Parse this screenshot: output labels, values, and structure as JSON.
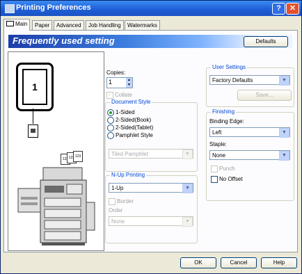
{
  "window": {
    "title": "Printing Preferences",
    "help_glyph": "?",
    "close_glyph": "✕"
  },
  "tabs": [
    {
      "label": "Main"
    },
    {
      "label": "Paper"
    },
    {
      "label": "Advanced"
    },
    {
      "label": "Job Handling"
    },
    {
      "label": "Watermarks"
    }
  ],
  "banner": {
    "title": "Frequently used setting",
    "defaults_label": "Defaults"
  },
  "preview": {
    "page_number": "1",
    "copies_labels": [
      "123",
      "123",
      "123"
    ]
  },
  "copies": {
    "label": "Copies:",
    "value": "1"
  },
  "collate": {
    "label": "Collate"
  },
  "document_style": {
    "label": "Document Style",
    "options": [
      "1-Sided",
      "2-Sided(Book)",
      "2-Sided(Tablet)",
      "Pamphlet Style"
    ],
    "selected": "1-Sided",
    "pamphlet_select": "Tiled Pamphlet"
  },
  "nup": {
    "label": "N-Up Printing",
    "value": "1-Up",
    "border_label": "Border",
    "order_label": "Order",
    "order_value": "None"
  },
  "user_settings": {
    "label": "User Settings",
    "value": "Factory Defaults",
    "save_label": "Save..."
  },
  "finishing": {
    "label": "Finishing",
    "binding_label": "Binding Edge:",
    "binding_value": "Left",
    "staple_label": "Staple:",
    "staple_value": "None",
    "punch_label": "Punch",
    "nooffset_label": "No Offset"
  },
  "buttons": {
    "ok": "OK",
    "cancel": "Cancel",
    "help": "Help"
  },
  "colors": {
    "title_bar": "#1f5fd8",
    "banner": "#1b3da8",
    "group_label": "#0046d5",
    "dialog_bg": "#ece9d8"
  }
}
